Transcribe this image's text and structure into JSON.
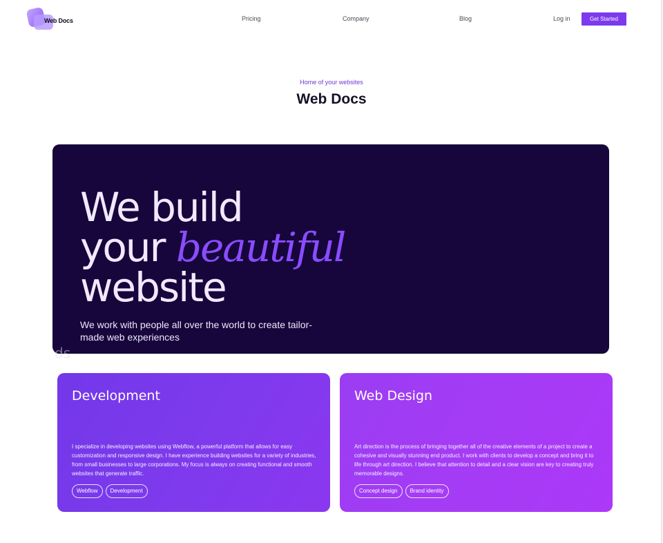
{
  "nav": {
    "logo_text": "Web Docs",
    "links": [
      "Pricing",
      "Company",
      "Blog"
    ],
    "login_label": "Log in",
    "cta_label": "Get Started"
  },
  "header": {
    "eyebrow": "Home of your websites",
    "title": "Web Docs"
  },
  "hero": {
    "line1": "We build",
    "line2_prefix": "your ",
    "line2_accent": "beautiful",
    "line3": "website",
    "subtitle": "We work with people all over the world to create tailor-made web experiences",
    "ghost_text": "ds"
  },
  "cards": [
    {
      "title": "Development",
      "body": "I specialize in developing websites using Webflow, a powerful platform that allows for easy customization and responsive design. I have experience building websites for a variety of industries, from small businesses to large corporations. My focus is always on creating functional and smooth websites that generate traffic.",
      "tags": [
        "Webflow",
        "Development"
      ]
    },
    {
      "title": "Web Design",
      "body": "Art direction is the process of bringing together all of the creative elements of a project to create a cohesive and visually stunning end product. I work with clients to develop a concept and bring it to life through art direction. I believe that attention to detail and a clear vision are key to creating truly memorable designs.",
      "tags": [
        "Concept design",
        "Brand identity"
      ]
    }
  ],
  "colors": {
    "accent": "#7c3aed",
    "hero_bg": "#16063b",
    "hero_accent": "#8a4cff",
    "card_dev": "#7c3aec",
    "card_design": "#a43cf5"
  }
}
